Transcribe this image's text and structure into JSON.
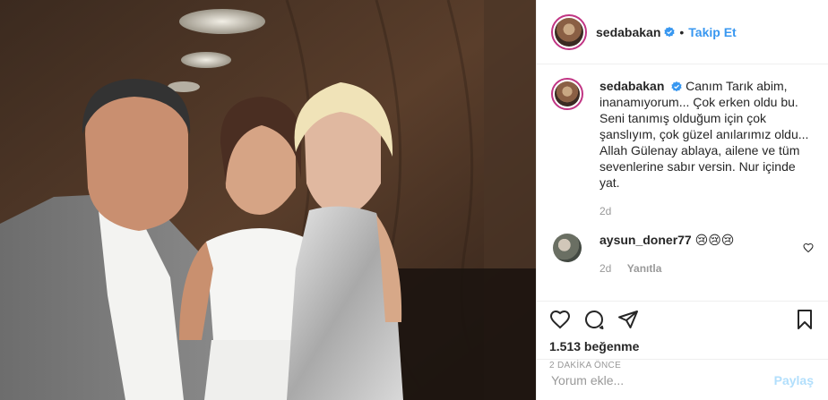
{
  "header": {
    "username": "sedabakan",
    "separator": "•",
    "follow_label": "Takip Et",
    "verified_icon": "verified-badge-icon"
  },
  "caption": {
    "username": "sedabakan",
    "text": "Canım Tarık abim, inanamıyorum... Çok erken oldu bu. Seni tanımış olduğum için çok şanslıyım, çok güzel anılarımız oldu... Allah Gülenay ablaya, ailene ve tüm sevenlerine sabır versin. Nur içinde yat.",
    "age": "2d"
  },
  "comment": {
    "username": "aysun_doner77",
    "text": "😢😢😢",
    "age": "2d",
    "reply_label": "Yanıtla"
  },
  "actions": {
    "like_icon": "heart-icon",
    "comment_icon": "comment-icon",
    "share_icon": "share-icon",
    "save_icon": "bookmark-icon",
    "likes_text": "1.513 beğenme",
    "timestamp": "2 DAKİKA ÖNCE"
  },
  "add_comment": {
    "placeholder": "Yorum ekle...",
    "post_label": "Paylaş"
  },
  "colors": {
    "accent": "#3897f0",
    "post_disabled": "#b2dffc",
    "muted": "#999999",
    "border": "#efefef"
  }
}
